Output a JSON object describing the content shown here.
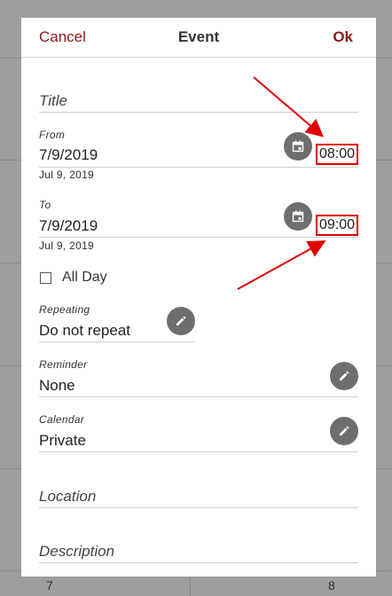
{
  "header": {
    "cancel": "Cancel",
    "title": "Event",
    "ok": "Ok"
  },
  "title_field": {
    "placeholder": "Title"
  },
  "from": {
    "label": "From",
    "date": "7/9/2019",
    "date_long": "Jul 9, 2019",
    "time": "08:00"
  },
  "to": {
    "label": "To",
    "date": "7/9/2019",
    "date_long": "Jul 9, 2019",
    "time": "09:00"
  },
  "all_day": {
    "label": "All Day",
    "checked": false
  },
  "repeating": {
    "label": "Repeating",
    "value": "Do not repeat"
  },
  "reminder": {
    "label": "Reminder",
    "value": "None"
  },
  "calendar": {
    "label": "Calendar",
    "value": "Private"
  },
  "location": {
    "placeholder": "Location"
  },
  "description": {
    "placeholder": "Description"
  },
  "background": {
    "day_left": "7",
    "day_right": "8"
  },
  "colors": {
    "accent": "#8b1a1a",
    "highlight": "#e00000",
    "fab": "#6e6e6e"
  },
  "icons": {
    "date_picker": "calendar-icon",
    "edit": "pencil-icon"
  }
}
